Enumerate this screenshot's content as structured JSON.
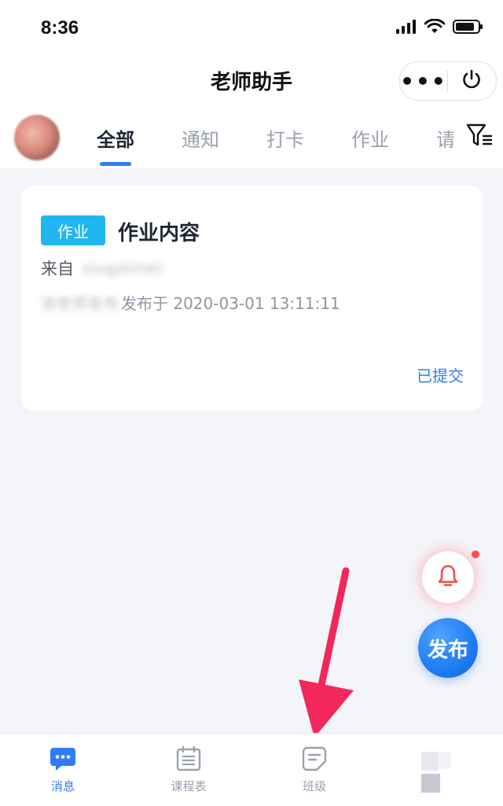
{
  "status_bar": {
    "time": "8:36"
  },
  "nav": {
    "title": "老师助手",
    "more_label": "•••"
  },
  "tabs": [
    {
      "label": "全部",
      "active": true
    },
    {
      "label": "通知",
      "active": false
    },
    {
      "label": "打卡",
      "active": false
    },
    {
      "label": "作业",
      "active": false
    },
    {
      "label": "请",
      "active": false
    }
  ],
  "card": {
    "tag": "作业",
    "title": "作业内容",
    "from_label": "来自",
    "from_value": "xiugaimei",
    "author": "张老师发布",
    "published_text": "发布于 2020-03-01 13:11:11",
    "status": "已提交"
  },
  "fab": {
    "publish_label": "发布"
  },
  "tabbar": [
    {
      "label": "消息",
      "icon": "chat-bubble-icon",
      "active": true
    },
    {
      "label": "课程表",
      "icon": "calendar-icon",
      "active": false
    },
    {
      "label": "班级",
      "icon": "note-icon",
      "active": false
    },
    {
      "label": "",
      "icon": "profile-icon",
      "active": false
    }
  ],
  "colors": {
    "accent": "#2f7cf6",
    "tag": "#1fb6f2",
    "arrow": "#f2275a",
    "notify_dot": "#ff4d4f",
    "background": "#f4f5f9"
  }
}
